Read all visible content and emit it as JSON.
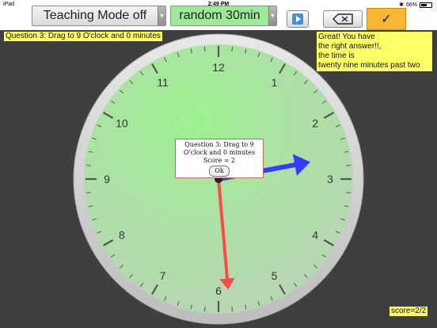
{
  "status_bar": {
    "device": "iPad",
    "time": "2:49 PM",
    "battery": "66%",
    "wifi_icon": "wifi-icon",
    "bluetooth_icon": "bluetooth-icon"
  },
  "toolbar": {
    "teaching_mode": "Teaching Mode off",
    "random_mode": "random 30min",
    "play_icon": "play-icon",
    "backspace_icon": "backspace-icon",
    "check_label": "✓",
    "colors": {
      "random_bg": "#9ee89a",
      "check_bg": "#f5b735"
    }
  },
  "question": "Question 3: Drag to 9 O'clock and 0 minutes",
  "feedback": {
    "line1": "Great! You have",
    "line2": "the right answer!!,",
    "line3": "the time is",
    "line4": "twenty nine minutes past two"
  },
  "score": "score=2/2",
  "dialog": {
    "line1": "Question 3: Drag to 9",
    "line2": "O'clock and 0 minutes",
    "line3": "Score = 2",
    "ok": "Ok"
  },
  "clock": {
    "numbers": [
      "12",
      "1",
      "2",
      "3",
      "4",
      "5",
      "6",
      "7",
      "8",
      "9",
      "10",
      "11"
    ],
    "hour": 2,
    "minute": 29,
    "hour_hand_color": "#3a3aff",
    "minute_hand_color": "#ff4a4a",
    "face_color": "#a6e3a0"
  }
}
